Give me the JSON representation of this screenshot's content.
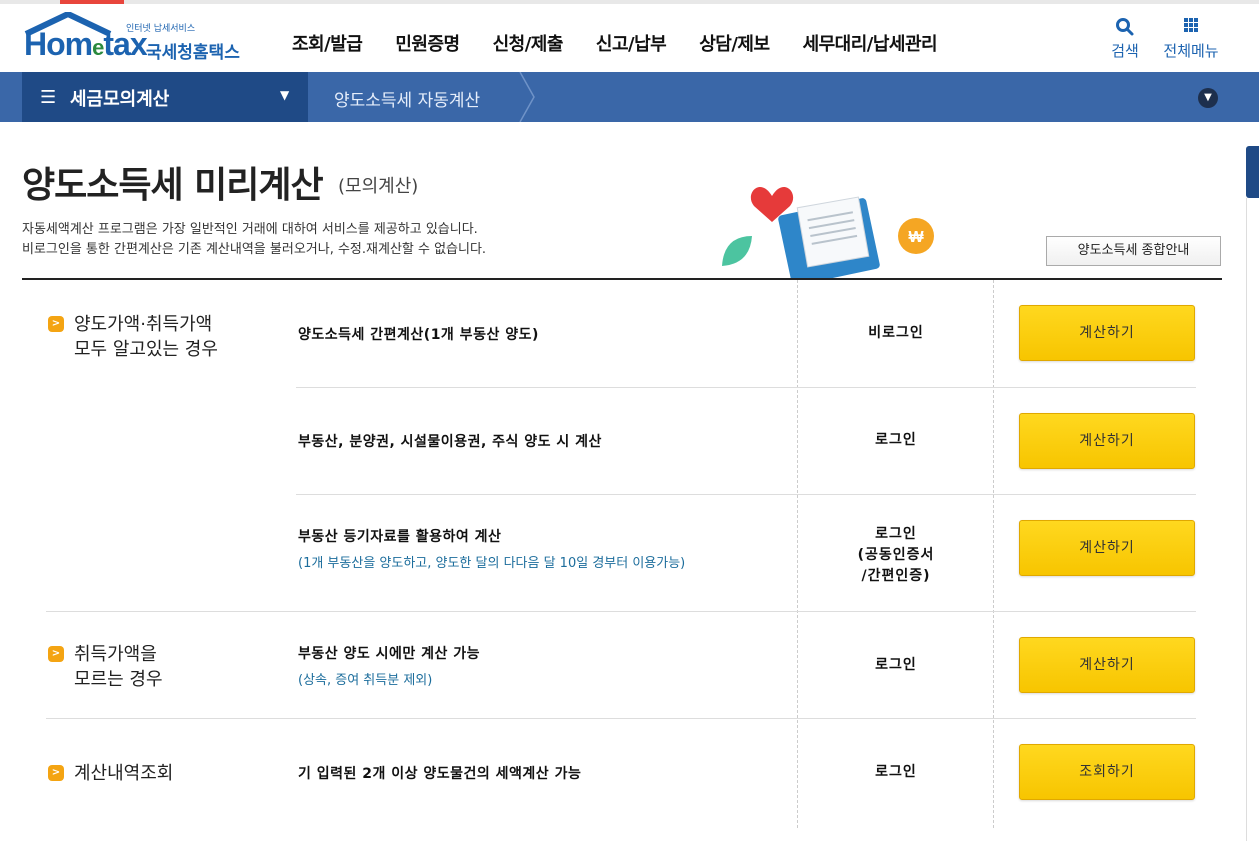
{
  "header": {
    "logo_brand": "Hom",
    "logo_brand_e": "e",
    "logo_brand_tax": "tax",
    "logo_tagline": "인터넷 납세서비스",
    "logo_name": "국세청홈택스",
    "nav": [
      "조회/발급",
      "민원증명",
      "신청/제출",
      "신고/납부",
      "상담/제보",
      "세무대리/납세관리"
    ],
    "search_label": "검색",
    "all_menu_label": "전체메뉴"
  },
  "subnav": {
    "section_label": "세금모의계산",
    "current_page": "양도소득세 자동계산"
  },
  "page": {
    "title": "양도소득세 미리계산",
    "title_sub": "(모의계산)",
    "desc_line1": "자동세액계산 프로그램은 가장 일반적인 거래에 대하여 서비스를 제공하고 있습니다.",
    "desc_line2": "비로그인을 통한 간편계산은 기존 계산내역을 불러오거나, 수정.재계산할 수 없습니다.",
    "guide_button": "양도소득세 종합안내"
  },
  "categories": [
    {
      "line1": "양도가액·취득가액",
      "line2": "모두 알고있는 경우"
    },
    {
      "line1": "취득가액을",
      "line2": "모르는 경우"
    },
    {
      "line1": "계산내역조회",
      "line2": ""
    }
  ],
  "rows": [
    {
      "service": "양도소득세 간편계산(1개 부동산 양도)",
      "note": "",
      "login_l1": "비로그인",
      "login_l2": "",
      "login_l3": "",
      "button": "계산하기"
    },
    {
      "service": "부동산, 분양권, 시설물이용권, 주식 양도 시 계산",
      "note": "",
      "login_l1": "로그인",
      "login_l2": "",
      "login_l3": "",
      "button": "계산하기"
    },
    {
      "service": "부동산 등기자료를 활용하여 계산",
      "note": "(1개 부동산을 양도하고, 양도한 달의 다다음 달 10일 경부터 이용가능)",
      "login_l1": "로그인",
      "login_l2": "(공동인증서",
      "login_l3": "/간편인증)",
      "button": "계산하기"
    },
    {
      "service": "부동산 양도 시에만 계산 가능",
      "note": "(상속, 증여 취득분 제외)",
      "login_l1": "로그인",
      "login_l2": "",
      "login_l3": "",
      "button": "계산하기"
    },
    {
      "service": "기 입력된 2개 이상 양도물건의 세액계산 가능",
      "note": "",
      "login_l1": "로그인",
      "login_l2": "",
      "login_l3": "",
      "button": "조회하기"
    }
  ]
}
